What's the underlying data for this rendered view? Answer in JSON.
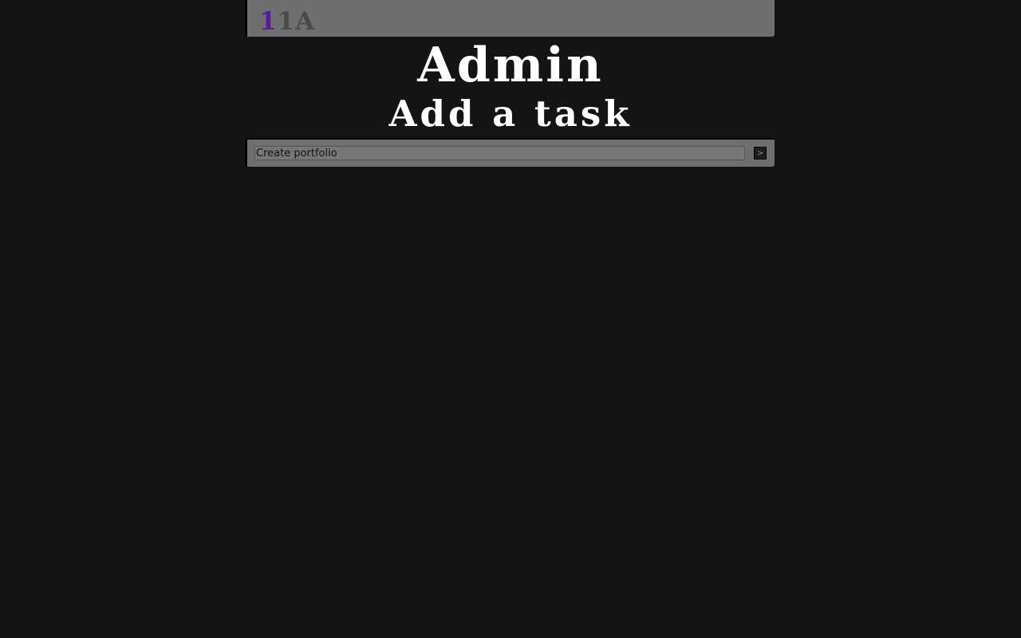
{
  "header": {
    "logo_part1": "1",
    "logo_part2": "1A"
  },
  "main": {
    "title": "Admin",
    "subtitle": "Add a task"
  },
  "task_form": {
    "input_value": "Create portfolio",
    "submit_label": ">"
  },
  "colors": {
    "background": "#141414",
    "bar": "#6f6f6f",
    "logo_accent": "#5a1a9a",
    "logo_muted": "#4a4a4a",
    "text": "#ffffff"
  }
}
